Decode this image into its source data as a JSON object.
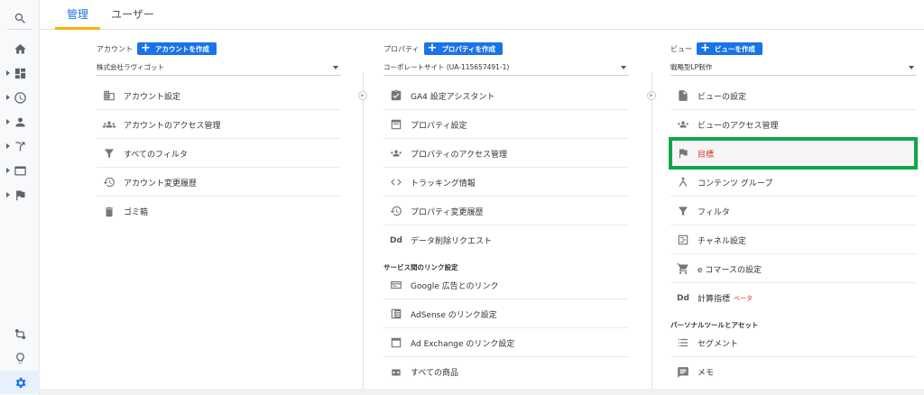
{
  "tabs": {
    "admin": "管理",
    "users": "ユーザー"
  },
  "account": {
    "header_label": "アカウント",
    "create_label": "アカウントを作成",
    "selected": "株式会社ラヴィゴット",
    "items": [
      {
        "label": "アカウント設定",
        "icon": "building-icon"
      },
      {
        "label": "アカウントのアクセス管理",
        "icon": "people-icon"
      },
      {
        "label": "すべてのフィルタ",
        "icon": "filter-icon"
      },
      {
        "label": "アカウント変更履歴",
        "icon": "history-icon"
      },
      {
        "label": "ゴミ箱",
        "icon": "trash-icon"
      }
    ]
  },
  "property": {
    "header_label": "プロパティ",
    "create_label": "プロパティを作成",
    "selected": "コーポレートサイト (UA-115657491-1)",
    "items": [
      {
        "label": "GA4 設定アシスタント",
        "icon": "checklist-icon"
      },
      {
        "label": "プロパティ設定",
        "icon": "window-icon"
      },
      {
        "label": "プロパティのアクセス管理",
        "icon": "people-icon"
      },
      {
        "label": "トラッキング情報",
        "icon": "code-icon"
      },
      {
        "label": "プロパティ変更履歴",
        "icon": "history-icon"
      },
      {
        "label": "データ削除リクエスト",
        "icon": "dd-icon",
        "icon_text": "Dd"
      }
    ],
    "section_title": "サービス間のリンク設定",
    "link_items": [
      {
        "label": "Google 広告とのリンク",
        "icon": "ads-icon"
      },
      {
        "label": "AdSense のリンク設定",
        "icon": "adsense-icon"
      },
      {
        "label": "Ad Exchange のリンク設定",
        "icon": "window-icon"
      },
      {
        "label": "すべての商品",
        "icon": "link-icon"
      }
    ]
  },
  "view": {
    "header_label": "ビュー",
    "create_label": "ビューを作成",
    "selected": "戦略型LP制作",
    "items": [
      {
        "label": "ビューの設定",
        "icon": "document-icon"
      },
      {
        "label": "ビューのアクセス管理",
        "icon": "people-icon"
      },
      {
        "label": "目標",
        "icon": "flag-icon"
      },
      {
        "label": "コンテンツ グループ",
        "icon": "content-group-icon"
      },
      {
        "label": "フィルタ",
        "icon": "filter-icon"
      },
      {
        "label": "チャネル設定",
        "icon": "channel-icon"
      },
      {
        "label": "e コマースの設定",
        "icon": "cart-icon"
      },
      {
        "label": "計算指標",
        "icon": "dd-icon",
        "icon_text": "Dd",
        "badge": "ベータ"
      }
    ],
    "section_title": "パーソナルツールとアセット",
    "tool_items": [
      {
        "label": "セグメント",
        "icon": "segment-icon"
      },
      {
        "label": "メモ",
        "icon": "note-icon"
      }
    ]
  },
  "colors": {
    "accent": "#1a73e8",
    "highlight_box": "#10a64a",
    "tab_underline": "#f4b400",
    "selected_text": "#d93025"
  }
}
